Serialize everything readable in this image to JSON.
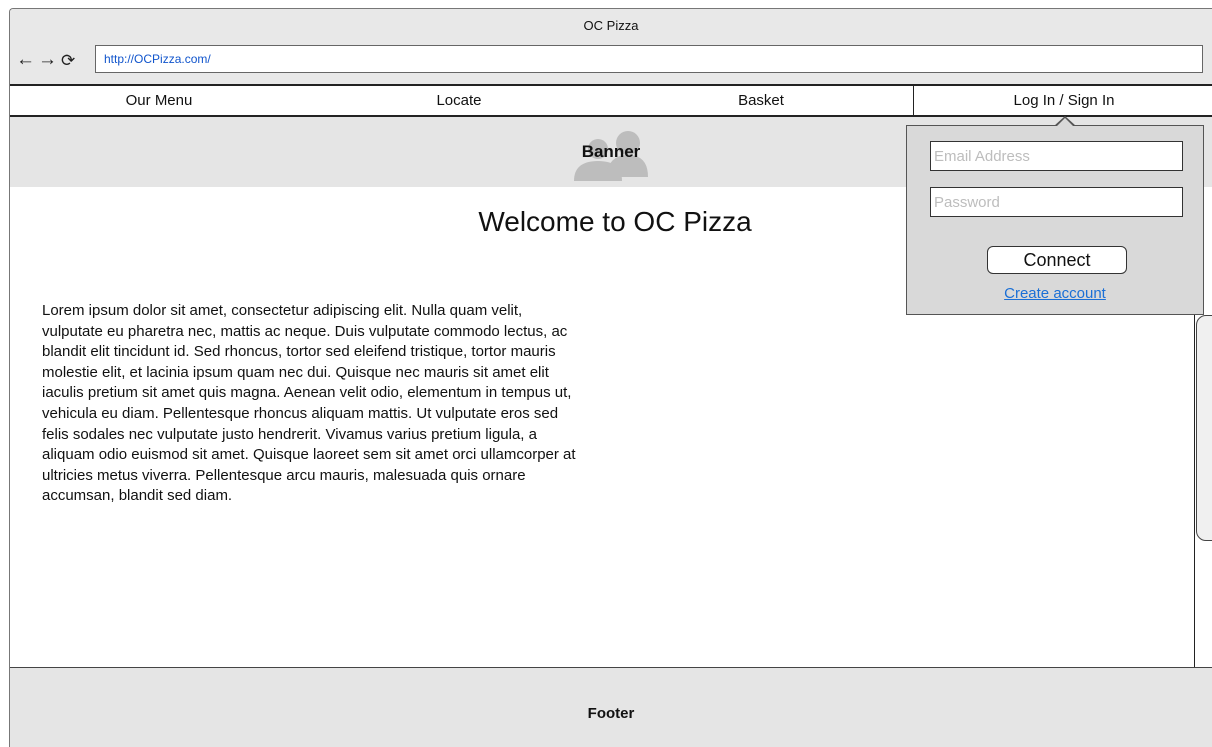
{
  "window": {
    "title": "OC Pizza"
  },
  "browser": {
    "back_icon": "←",
    "forward_icon": "→",
    "reload_icon": "⟳",
    "url": "http://OCPizza.com/"
  },
  "menu": {
    "items": [
      {
        "label": "Our Menu"
      },
      {
        "label": "Locate"
      },
      {
        "label": "Basket"
      },
      {
        "label": "Log In / Sign In"
      }
    ]
  },
  "banner": {
    "label": "Banner",
    "icon": "image-placeholder-icon"
  },
  "main": {
    "heading": "Welcome to OC Pizza",
    "body": "Lorem ipsum dolor sit amet, consectetur adipiscing elit. Nulla quam velit, vulputate eu pharetra nec, mattis ac neque. Duis vulputate commodo lectus, ac blandit elit tincidunt id. Sed rhoncus, tortor sed eleifend tristique, tortor mauris molestie elit, et lacinia ipsum quam nec dui. Quisque nec mauris sit amet elit iaculis pretium sit amet quis magna. Aenean velit odio, elementum in tempus ut, vehicula eu diam. Pellentesque rhoncus aliquam mattis. Ut vulputate eros sed felis sodales nec vulputate justo hendrerit. Vivamus varius pretium ligula, a aliquam odio euismod sit amet. Quisque laoreet sem sit amet orci ullamcorper at ultricies metus viverra. Pellentesque arcu mauris, malesuada quis ornare accumsan, blandit sed diam."
  },
  "login_popup": {
    "email_placeholder": "Email Address",
    "password_placeholder": "Password",
    "connect_label": "Connect",
    "create_account_label": "Create account"
  },
  "footer": {
    "label": "Footer"
  },
  "colors": {
    "link": "#1a6fd6",
    "url_text": "#1155cc",
    "panel_gray": "#e5e5e5",
    "popup_gray": "#d9d9d9"
  }
}
